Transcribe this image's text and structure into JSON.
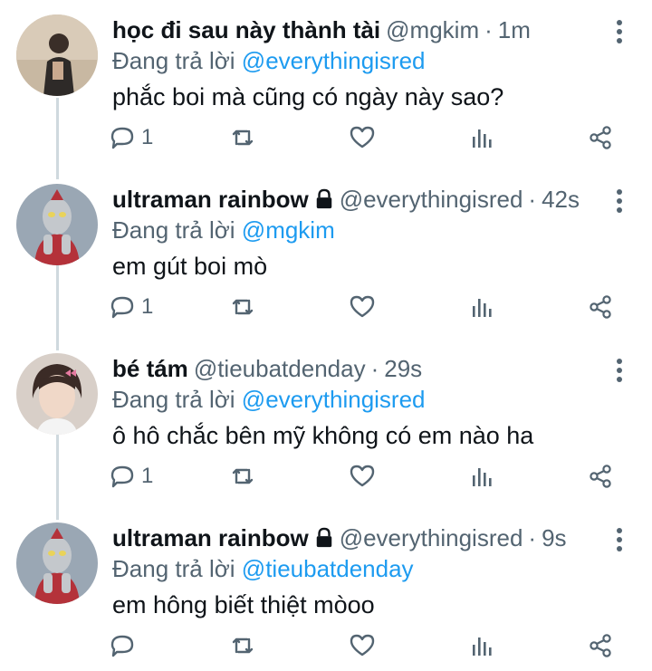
{
  "tweets": [
    {
      "name": "học đi sau này thành tài",
      "locked": false,
      "handle": "@mgkim",
      "time": "1m",
      "reply_prefix": "Đang trả lời",
      "reply_to": "@everythingisred",
      "text": "phắc boi mà cũng có ngày này sao?",
      "reply_count": "1",
      "avatar": "avatar-person-sitting"
    },
    {
      "name": "ultraman rainbow",
      "locked": true,
      "handle": "@everythingisred",
      "time": "42s",
      "reply_prefix": "Đang trả lời",
      "reply_to": "@mgkim",
      "text": "em gút boi mò",
      "reply_count": "1",
      "avatar": "avatar-ultraman"
    },
    {
      "name": "bé tám",
      "locked": false,
      "handle": "@tieubatdenday",
      "time": "29s",
      "reply_prefix": "Đang trả lời",
      "reply_to": "@everythingisred",
      "text": "ô hô chắc bên mỹ không có em nào ha",
      "reply_count": "1",
      "avatar": "avatar-person-bow"
    },
    {
      "name": "ultraman rainbow",
      "locked": true,
      "handle": "@everythingisred",
      "time": "9s",
      "reply_prefix": "Đang trả lời",
      "reply_to": "@tieubatdenday",
      "text": "em hông biết thiệt mòoo",
      "reply_count": "",
      "avatar": "avatar-ultraman"
    }
  ],
  "separator": "·",
  "colors": {
    "mention": "#1d9bf0",
    "secondary": "#536471",
    "thread_line": "#cfd9de"
  }
}
